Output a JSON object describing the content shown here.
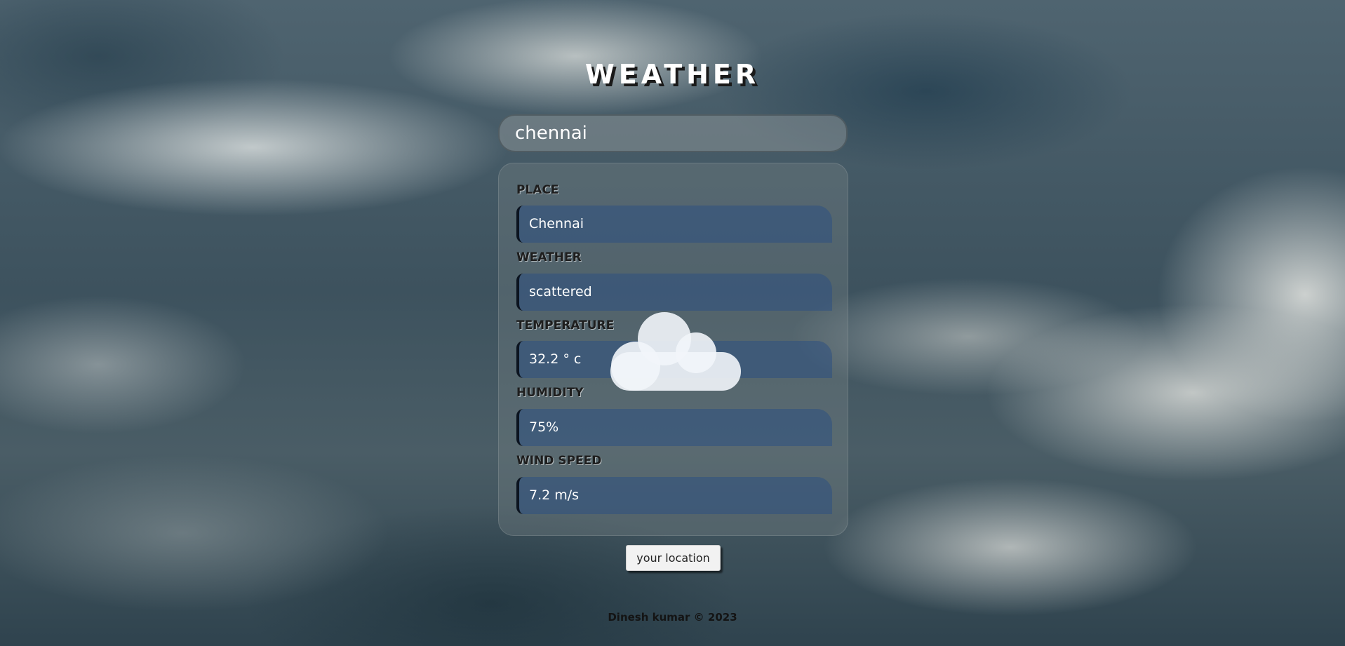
{
  "header": {
    "title": "WEATHER"
  },
  "search": {
    "value": "chennai"
  },
  "fields": [
    {
      "label": "PLACE",
      "value": "Chennai"
    },
    {
      "label": "WEATHER",
      "value": "scattered"
    },
    {
      "label": "TEMPERATURE",
      "value": "32.2 ° c"
    },
    {
      "label": "HUMIDITY",
      "value": "75%"
    },
    {
      "label": "WIND SPEED",
      "value": "7.2 m/s"
    }
  ],
  "weather_icon": "cloud-icon",
  "location_button": {
    "label": "your location"
  },
  "footer": {
    "text": "Dinesh kumar © 2023"
  }
}
